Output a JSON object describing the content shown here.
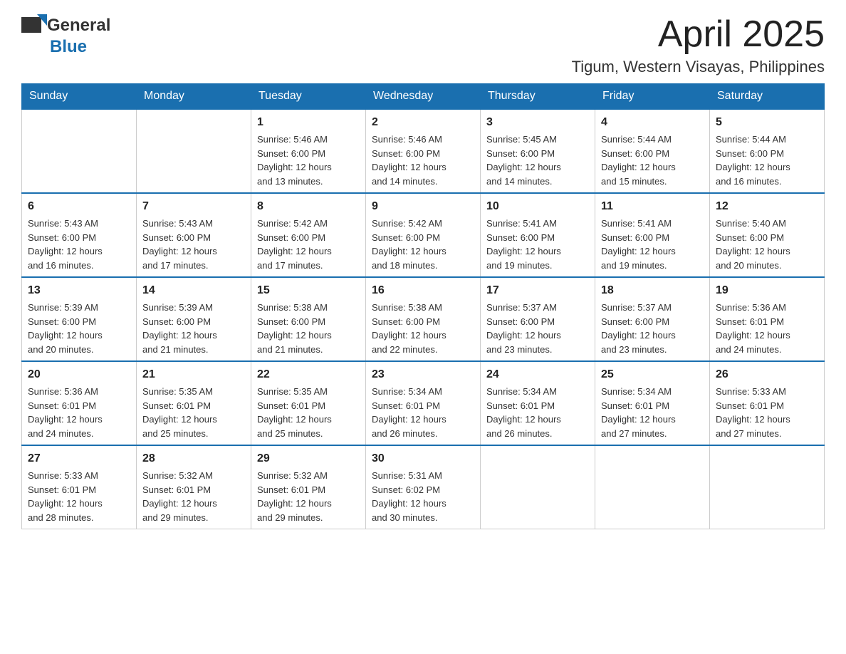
{
  "header": {
    "logo_general": "General",
    "logo_blue": "Blue",
    "title": "April 2025",
    "subtitle": "Tigum, Western Visayas, Philippines"
  },
  "weekdays": [
    "Sunday",
    "Monday",
    "Tuesday",
    "Wednesday",
    "Thursday",
    "Friday",
    "Saturday"
  ],
  "weeks": [
    [
      {
        "day": "",
        "info": ""
      },
      {
        "day": "",
        "info": ""
      },
      {
        "day": "1",
        "info": "Sunrise: 5:46 AM\nSunset: 6:00 PM\nDaylight: 12 hours\nand 13 minutes."
      },
      {
        "day": "2",
        "info": "Sunrise: 5:46 AM\nSunset: 6:00 PM\nDaylight: 12 hours\nand 14 minutes."
      },
      {
        "day": "3",
        "info": "Sunrise: 5:45 AM\nSunset: 6:00 PM\nDaylight: 12 hours\nand 14 minutes."
      },
      {
        "day": "4",
        "info": "Sunrise: 5:44 AM\nSunset: 6:00 PM\nDaylight: 12 hours\nand 15 minutes."
      },
      {
        "day": "5",
        "info": "Sunrise: 5:44 AM\nSunset: 6:00 PM\nDaylight: 12 hours\nand 16 minutes."
      }
    ],
    [
      {
        "day": "6",
        "info": "Sunrise: 5:43 AM\nSunset: 6:00 PM\nDaylight: 12 hours\nand 16 minutes."
      },
      {
        "day": "7",
        "info": "Sunrise: 5:43 AM\nSunset: 6:00 PM\nDaylight: 12 hours\nand 17 minutes."
      },
      {
        "day": "8",
        "info": "Sunrise: 5:42 AM\nSunset: 6:00 PM\nDaylight: 12 hours\nand 17 minutes."
      },
      {
        "day": "9",
        "info": "Sunrise: 5:42 AM\nSunset: 6:00 PM\nDaylight: 12 hours\nand 18 minutes."
      },
      {
        "day": "10",
        "info": "Sunrise: 5:41 AM\nSunset: 6:00 PM\nDaylight: 12 hours\nand 19 minutes."
      },
      {
        "day": "11",
        "info": "Sunrise: 5:41 AM\nSunset: 6:00 PM\nDaylight: 12 hours\nand 19 minutes."
      },
      {
        "day": "12",
        "info": "Sunrise: 5:40 AM\nSunset: 6:00 PM\nDaylight: 12 hours\nand 20 minutes."
      }
    ],
    [
      {
        "day": "13",
        "info": "Sunrise: 5:39 AM\nSunset: 6:00 PM\nDaylight: 12 hours\nand 20 minutes."
      },
      {
        "day": "14",
        "info": "Sunrise: 5:39 AM\nSunset: 6:00 PM\nDaylight: 12 hours\nand 21 minutes."
      },
      {
        "day": "15",
        "info": "Sunrise: 5:38 AM\nSunset: 6:00 PM\nDaylight: 12 hours\nand 21 minutes."
      },
      {
        "day": "16",
        "info": "Sunrise: 5:38 AM\nSunset: 6:00 PM\nDaylight: 12 hours\nand 22 minutes."
      },
      {
        "day": "17",
        "info": "Sunrise: 5:37 AM\nSunset: 6:00 PM\nDaylight: 12 hours\nand 23 minutes."
      },
      {
        "day": "18",
        "info": "Sunrise: 5:37 AM\nSunset: 6:00 PM\nDaylight: 12 hours\nand 23 minutes."
      },
      {
        "day": "19",
        "info": "Sunrise: 5:36 AM\nSunset: 6:01 PM\nDaylight: 12 hours\nand 24 minutes."
      }
    ],
    [
      {
        "day": "20",
        "info": "Sunrise: 5:36 AM\nSunset: 6:01 PM\nDaylight: 12 hours\nand 24 minutes."
      },
      {
        "day": "21",
        "info": "Sunrise: 5:35 AM\nSunset: 6:01 PM\nDaylight: 12 hours\nand 25 minutes."
      },
      {
        "day": "22",
        "info": "Sunrise: 5:35 AM\nSunset: 6:01 PM\nDaylight: 12 hours\nand 25 minutes."
      },
      {
        "day": "23",
        "info": "Sunrise: 5:34 AM\nSunset: 6:01 PM\nDaylight: 12 hours\nand 26 minutes."
      },
      {
        "day": "24",
        "info": "Sunrise: 5:34 AM\nSunset: 6:01 PM\nDaylight: 12 hours\nand 26 minutes."
      },
      {
        "day": "25",
        "info": "Sunrise: 5:34 AM\nSunset: 6:01 PM\nDaylight: 12 hours\nand 27 minutes."
      },
      {
        "day": "26",
        "info": "Sunrise: 5:33 AM\nSunset: 6:01 PM\nDaylight: 12 hours\nand 27 minutes."
      }
    ],
    [
      {
        "day": "27",
        "info": "Sunrise: 5:33 AM\nSunset: 6:01 PM\nDaylight: 12 hours\nand 28 minutes."
      },
      {
        "day": "28",
        "info": "Sunrise: 5:32 AM\nSunset: 6:01 PM\nDaylight: 12 hours\nand 29 minutes."
      },
      {
        "day": "29",
        "info": "Sunrise: 5:32 AM\nSunset: 6:01 PM\nDaylight: 12 hours\nand 29 minutes."
      },
      {
        "day": "30",
        "info": "Sunrise: 5:31 AM\nSunset: 6:02 PM\nDaylight: 12 hours\nand 30 minutes."
      },
      {
        "day": "",
        "info": ""
      },
      {
        "day": "",
        "info": ""
      },
      {
        "day": "",
        "info": ""
      }
    ]
  ]
}
